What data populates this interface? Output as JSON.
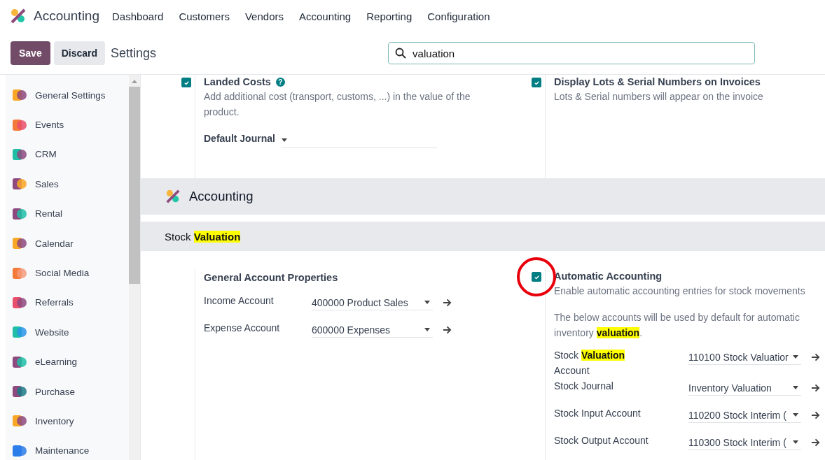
{
  "app": {
    "name": "Accounting"
  },
  "menu": [
    "Dashboard",
    "Customers",
    "Vendors",
    "Accounting",
    "Reporting",
    "Configuration"
  ],
  "control_bar": {
    "save": "Save",
    "discard": "Discard",
    "title": "Settings",
    "search": {
      "value": "valuation"
    }
  },
  "sidebar": {
    "items": [
      {
        "label": "General Settings",
        "selected": false
      },
      {
        "label": "Events",
        "selected": false
      },
      {
        "label": "CRM",
        "selected": false
      },
      {
        "label": "Sales",
        "selected": false
      },
      {
        "label": "Rental",
        "selected": false
      },
      {
        "label": "Calendar",
        "selected": false
      },
      {
        "label": "Social Media",
        "selected": false
      },
      {
        "label": "Referrals",
        "selected": false
      },
      {
        "label": "Website",
        "selected": false
      },
      {
        "label": "eLearning",
        "selected": false
      },
      {
        "label": "Purchase",
        "selected": false
      },
      {
        "label": "Inventory",
        "selected": false
      },
      {
        "label": "Maintenance",
        "selected": false
      }
    ]
  },
  "top_settings": [
    {
      "title": "Landed Costs",
      "help": "?",
      "checked": true,
      "description": "Add additional cost (transport, customs, ...) in the value of the product.",
      "fields": [
        {
          "label": "Default Journal"
        }
      ]
    },
    {
      "title": "Display Lots & Serial Numbers on Invoices",
      "checked": true,
      "description": "Lots & Serial numbers will appear on the invoice"
    }
  ],
  "section": {
    "title": "Accounting"
  },
  "subsection": {
    "title": [
      {
        "text": "Stock ",
        "highlight": false
      },
      {
        "text": "Valuation",
        "highlight": true
      }
    ]
  },
  "valuation_settings": [
    {
      "title": "General Account Properties",
      "fields": [
        {
          "label": [
            {
              "text": "Income Account",
              "highlight": false
            }
          ],
          "value": "400000 Product Sales"
        },
        {
          "label": [
            {
              "text": "Expense Account",
              "highlight": false
            }
          ],
          "value": "600000 Expenses"
        }
      ]
    },
    {
      "title": "Automatic Accounting",
      "checked": true,
      "circled": true,
      "description": "Enable automatic accounting entries for stock movements",
      "note": [
        {
          "text": "The below accounts will be used by default for automatic inventory ",
          "highlight": false
        },
        {
          "text": "valuation",
          "highlight": true
        },
        {
          "text": ".",
          "highlight": false
        }
      ],
      "fields": [
        {
          "label": [
            {
              "text": "Stock ",
              "highlight": false
            },
            {
              "text": "Valuation",
              "highlight": true
            },
            {
              "text": " Account",
              "highlight": false
            }
          ],
          "value": "110100 Stock Valuatior"
        },
        {
          "label": [
            {
              "text": "Stock Journal",
              "highlight": false
            }
          ],
          "value": "Inventory Valuation"
        },
        {
          "label": [
            {
              "text": "Stock Input Account",
              "highlight": false
            }
          ],
          "value": "110200 Stock Interim ("
        },
        {
          "label": [
            {
              "text": "Stock Output Account",
              "highlight": false
            }
          ],
          "value": "110300 Stock Interim ("
        }
      ]
    }
  ]
}
